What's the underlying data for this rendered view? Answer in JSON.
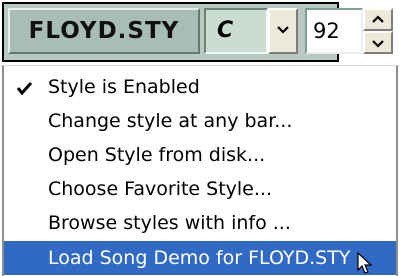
{
  "toolbar": {
    "style_name": "FLOYD.STY",
    "key": "C",
    "tempo": "92"
  },
  "menu": {
    "items": [
      {
        "label": "Style is Enabled",
        "checked": true,
        "highlighted": false
      },
      {
        "label": "Change style at any bar...",
        "checked": false,
        "highlighted": false
      },
      {
        "label": "Open Style from disk...",
        "checked": false,
        "highlighted": false
      },
      {
        "label": "Choose Favorite Style...",
        "checked": false,
        "highlighted": false
      },
      {
        "label": "Browse styles with info ...",
        "checked": false,
        "highlighted": false
      },
      {
        "label": "Load Song Demo for FLOYD.STY",
        "checked": false,
        "highlighted": true
      }
    ]
  },
  "colors": {
    "toolbar_bg": "#b7c9c1",
    "highlight": "#316ac5"
  },
  "icons": {
    "dropdown": "chevron-down-icon",
    "spinner_up": "chevron-up-icon",
    "spinner_down": "chevron-down-icon",
    "check": "check-icon",
    "cursor": "mouse-pointer-icon"
  }
}
